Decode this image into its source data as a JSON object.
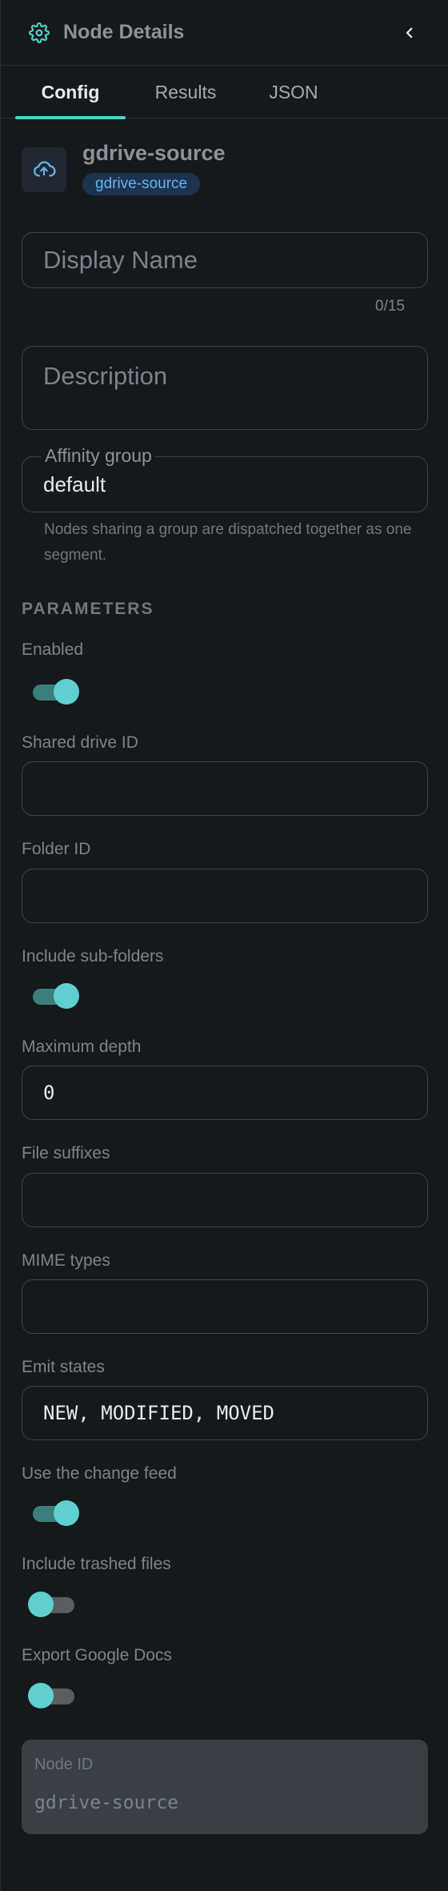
{
  "header": {
    "title": "Node Details",
    "gear_icon": "gear-icon",
    "collapse_icon": "chevron-left-icon"
  },
  "tabs": [
    {
      "label": "Config",
      "active": true
    },
    {
      "label": "Results",
      "active": false
    },
    {
      "label": "JSON",
      "active": false
    }
  ],
  "node": {
    "name": "gdrive-source",
    "type_badge": "gdrive-source",
    "icon": "cloud-upload-icon"
  },
  "display_name": {
    "placeholder": "Display Name",
    "value": "",
    "counter": "0/15"
  },
  "description": {
    "placeholder": "Description",
    "value": ""
  },
  "affinity": {
    "label": "Affinity group",
    "value": "default",
    "helper": "Nodes sharing a group are dispatched together as one segment."
  },
  "parameters": {
    "section_title": "PARAMETERS",
    "enabled": {
      "label": "Enabled",
      "on": true
    },
    "shared_drive_id": {
      "label": "Shared drive ID",
      "value": ""
    },
    "folder_id": {
      "label": "Folder ID",
      "value": ""
    },
    "include_subfolders": {
      "label": "Include sub-folders",
      "on": true
    },
    "maximum_depth": {
      "label": "Maximum depth",
      "value": "0"
    },
    "file_suffixes": {
      "label": "File suffixes",
      "value": ""
    },
    "mime_types": {
      "label": "MIME types",
      "value": ""
    },
    "emit_states": {
      "label": "Emit states",
      "value": "NEW, MODIFIED, MOVED"
    },
    "use_change_feed": {
      "label": "Use the change feed",
      "on": true
    },
    "include_trashed": {
      "label": "Include trashed files",
      "on": false
    },
    "export_google_docs": {
      "label": "Export Google Docs",
      "on": false
    }
  },
  "node_id": {
    "label": "Node ID",
    "value": "gdrive-source"
  },
  "colors": {
    "accent": "#4fd1c5",
    "toggle_thumb": "#5fd0cf",
    "badge_bg": "#1c3350",
    "badge_text": "#63b3ed",
    "background": "#16191c"
  }
}
